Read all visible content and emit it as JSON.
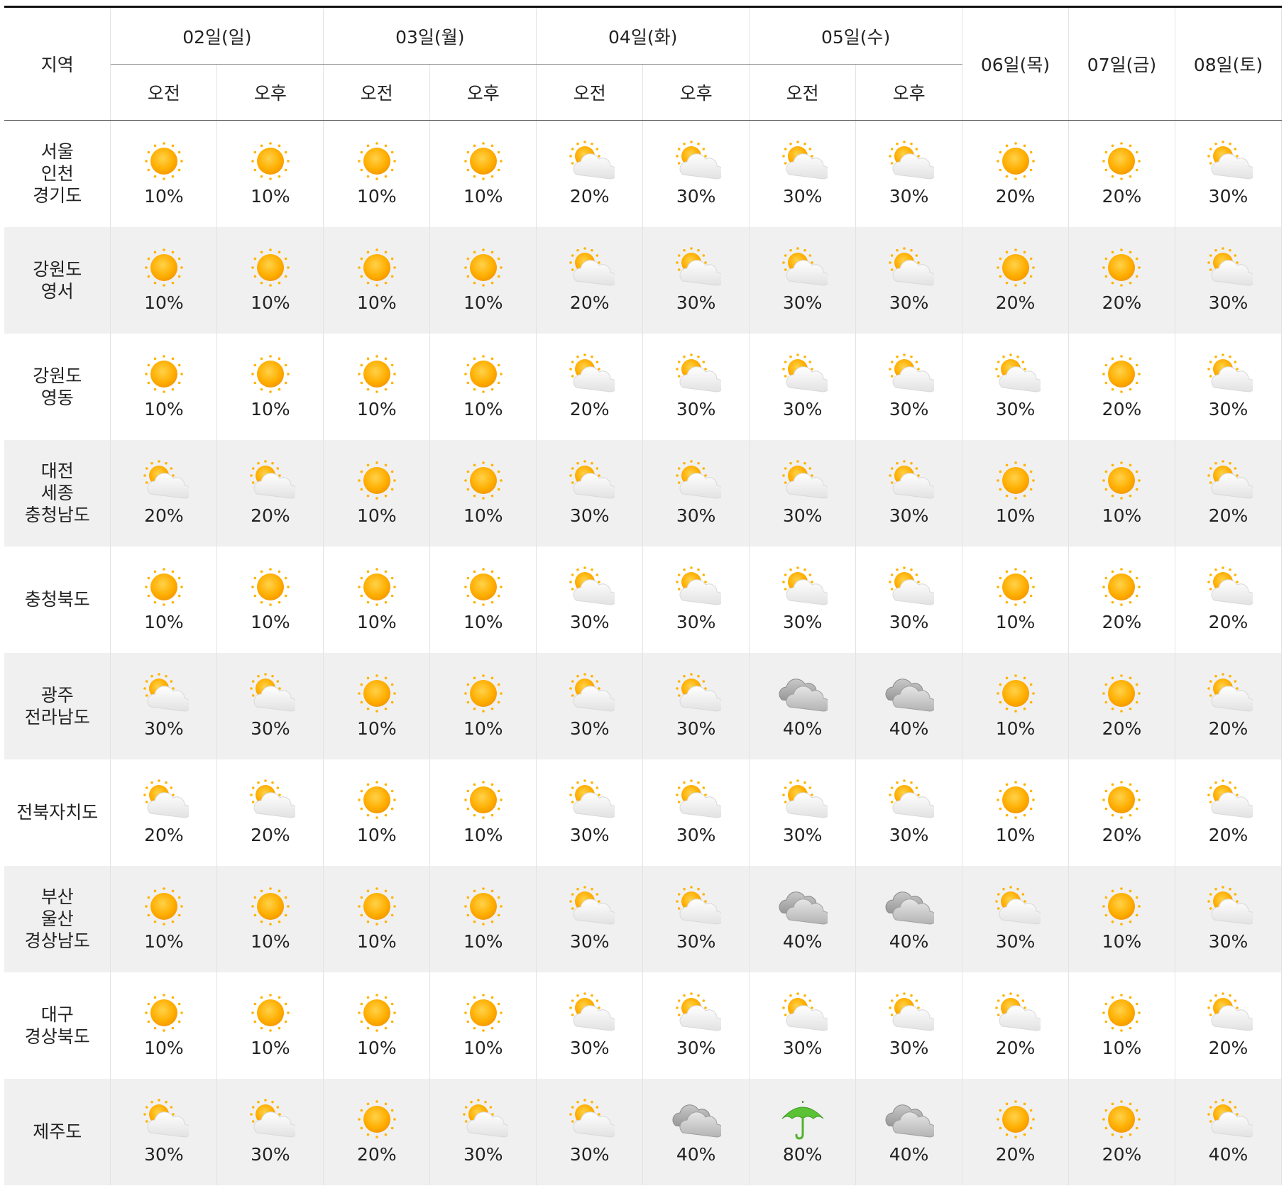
{
  "header": {
    "region_label": "지역",
    "days": [
      {
        "label": "02일(일)",
        "split": true
      },
      {
        "label": "03일(월)",
        "split": true
      },
      {
        "label": "04일(화)",
        "split": true
      },
      {
        "label": "05일(수)",
        "split": true
      },
      {
        "label": "06일(목)",
        "split": false
      },
      {
        "label": "07일(금)",
        "split": false
      },
      {
        "label": "08일(토)",
        "split": false
      }
    ],
    "am": "오전",
    "pm": "오후"
  },
  "rows": [
    {
      "region": [
        "서울",
        "인천",
        "경기도"
      ],
      "cells": [
        [
          "sunny-icon",
          "10%"
        ],
        [
          "sunny-icon",
          "10%"
        ],
        [
          "sunny-icon",
          "10%"
        ],
        [
          "sunny-icon",
          "10%"
        ],
        [
          "partly-cloudy-icon",
          "20%"
        ],
        [
          "partly-cloudy-icon",
          "30%"
        ],
        [
          "partly-cloudy-icon",
          "30%"
        ],
        [
          "partly-cloudy-icon",
          "30%"
        ],
        [
          "sunny-icon",
          "20%"
        ],
        [
          "sunny-icon",
          "20%"
        ],
        [
          "partly-cloudy-icon",
          "30%"
        ]
      ]
    },
    {
      "region": [
        "강원도",
        "영서"
      ],
      "cells": [
        [
          "sunny-icon",
          "10%"
        ],
        [
          "sunny-icon",
          "10%"
        ],
        [
          "sunny-icon",
          "10%"
        ],
        [
          "sunny-icon",
          "10%"
        ],
        [
          "partly-cloudy-icon",
          "20%"
        ],
        [
          "partly-cloudy-icon",
          "30%"
        ],
        [
          "partly-cloudy-icon",
          "30%"
        ],
        [
          "partly-cloudy-icon",
          "30%"
        ],
        [
          "sunny-icon",
          "20%"
        ],
        [
          "sunny-icon",
          "20%"
        ],
        [
          "partly-cloudy-icon",
          "30%"
        ]
      ]
    },
    {
      "region": [
        "강원도",
        "영동"
      ],
      "cells": [
        [
          "sunny-icon",
          "10%"
        ],
        [
          "sunny-icon",
          "10%"
        ],
        [
          "sunny-icon",
          "10%"
        ],
        [
          "sunny-icon",
          "10%"
        ],
        [
          "partly-cloudy-icon",
          "20%"
        ],
        [
          "partly-cloudy-icon",
          "30%"
        ],
        [
          "partly-cloudy-icon",
          "30%"
        ],
        [
          "partly-cloudy-icon",
          "30%"
        ],
        [
          "partly-cloudy-icon",
          "30%"
        ],
        [
          "sunny-icon",
          "20%"
        ],
        [
          "partly-cloudy-icon",
          "30%"
        ]
      ]
    },
    {
      "region": [
        "대전",
        "세종",
        "충청남도"
      ],
      "cells": [
        [
          "partly-cloudy-icon",
          "20%"
        ],
        [
          "partly-cloudy-icon",
          "20%"
        ],
        [
          "sunny-icon",
          "10%"
        ],
        [
          "sunny-icon",
          "10%"
        ],
        [
          "partly-cloudy-icon",
          "30%"
        ],
        [
          "partly-cloudy-icon",
          "30%"
        ],
        [
          "partly-cloudy-icon",
          "30%"
        ],
        [
          "partly-cloudy-icon",
          "30%"
        ],
        [
          "sunny-icon",
          "10%"
        ],
        [
          "sunny-icon",
          "10%"
        ],
        [
          "partly-cloudy-icon",
          "20%"
        ]
      ]
    },
    {
      "region": [
        "충청북도"
      ],
      "cells": [
        [
          "sunny-icon",
          "10%"
        ],
        [
          "sunny-icon",
          "10%"
        ],
        [
          "sunny-icon",
          "10%"
        ],
        [
          "sunny-icon",
          "10%"
        ],
        [
          "partly-cloudy-icon",
          "30%"
        ],
        [
          "partly-cloudy-icon",
          "30%"
        ],
        [
          "partly-cloudy-icon",
          "30%"
        ],
        [
          "partly-cloudy-icon",
          "30%"
        ],
        [
          "sunny-icon",
          "10%"
        ],
        [
          "sunny-icon",
          "20%"
        ],
        [
          "partly-cloudy-icon",
          "20%"
        ]
      ]
    },
    {
      "region": [
        "광주",
        "전라남도"
      ],
      "cells": [
        [
          "partly-cloudy-icon",
          "30%"
        ],
        [
          "partly-cloudy-icon",
          "30%"
        ],
        [
          "sunny-icon",
          "10%"
        ],
        [
          "sunny-icon",
          "10%"
        ],
        [
          "partly-cloudy-icon",
          "30%"
        ],
        [
          "partly-cloudy-icon",
          "30%"
        ],
        [
          "cloudy-icon",
          "40%"
        ],
        [
          "cloudy-icon",
          "40%"
        ],
        [
          "sunny-icon",
          "10%"
        ],
        [
          "sunny-icon",
          "20%"
        ],
        [
          "partly-cloudy-icon",
          "20%"
        ]
      ]
    },
    {
      "region": [
        "전북자치도"
      ],
      "cells": [
        [
          "partly-cloudy-icon",
          "20%"
        ],
        [
          "partly-cloudy-icon",
          "20%"
        ],
        [
          "sunny-icon",
          "10%"
        ],
        [
          "sunny-icon",
          "10%"
        ],
        [
          "partly-cloudy-icon",
          "30%"
        ],
        [
          "partly-cloudy-icon",
          "30%"
        ],
        [
          "partly-cloudy-icon",
          "30%"
        ],
        [
          "partly-cloudy-icon",
          "30%"
        ],
        [
          "sunny-icon",
          "10%"
        ],
        [
          "sunny-icon",
          "20%"
        ],
        [
          "partly-cloudy-icon",
          "20%"
        ]
      ]
    },
    {
      "region": [
        "부산",
        "울산",
        "경상남도"
      ],
      "cells": [
        [
          "sunny-icon",
          "10%"
        ],
        [
          "sunny-icon",
          "10%"
        ],
        [
          "sunny-icon",
          "10%"
        ],
        [
          "sunny-icon",
          "10%"
        ],
        [
          "partly-cloudy-icon",
          "30%"
        ],
        [
          "partly-cloudy-icon",
          "30%"
        ],
        [
          "cloudy-icon",
          "40%"
        ],
        [
          "cloudy-icon",
          "40%"
        ],
        [
          "partly-cloudy-icon",
          "30%"
        ],
        [
          "sunny-icon",
          "10%"
        ],
        [
          "partly-cloudy-icon",
          "30%"
        ]
      ]
    },
    {
      "region": [
        "대구",
        "경상북도"
      ],
      "cells": [
        [
          "sunny-icon",
          "10%"
        ],
        [
          "sunny-icon",
          "10%"
        ],
        [
          "sunny-icon",
          "10%"
        ],
        [
          "sunny-icon",
          "10%"
        ],
        [
          "partly-cloudy-icon",
          "30%"
        ],
        [
          "partly-cloudy-icon",
          "30%"
        ],
        [
          "partly-cloudy-icon",
          "30%"
        ],
        [
          "partly-cloudy-icon",
          "30%"
        ],
        [
          "partly-cloudy-icon",
          "20%"
        ],
        [
          "sunny-icon",
          "10%"
        ],
        [
          "partly-cloudy-icon",
          "20%"
        ]
      ]
    },
    {
      "region": [
        "제주도"
      ],
      "cells": [
        [
          "partly-cloudy-icon",
          "30%"
        ],
        [
          "partly-cloudy-icon",
          "30%"
        ],
        [
          "sunny-icon",
          "20%"
        ],
        [
          "partly-cloudy-icon",
          "30%"
        ],
        [
          "partly-cloudy-icon",
          "30%"
        ],
        [
          "cloudy-icon",
          "40%"
        ],
        [
          "rain-umbrella-icon",
          "80%"
        ],
        [
          "cloudy-icon",
          "40%"
        ],
        [
          "sunny-icon",
          "20%"
        ],
        [
          "sunny-icon",
          "20%"
        ],
        [
          "partly-cloudy-icon",
          "40%"
        ]
      ]
    }
  ]
}
